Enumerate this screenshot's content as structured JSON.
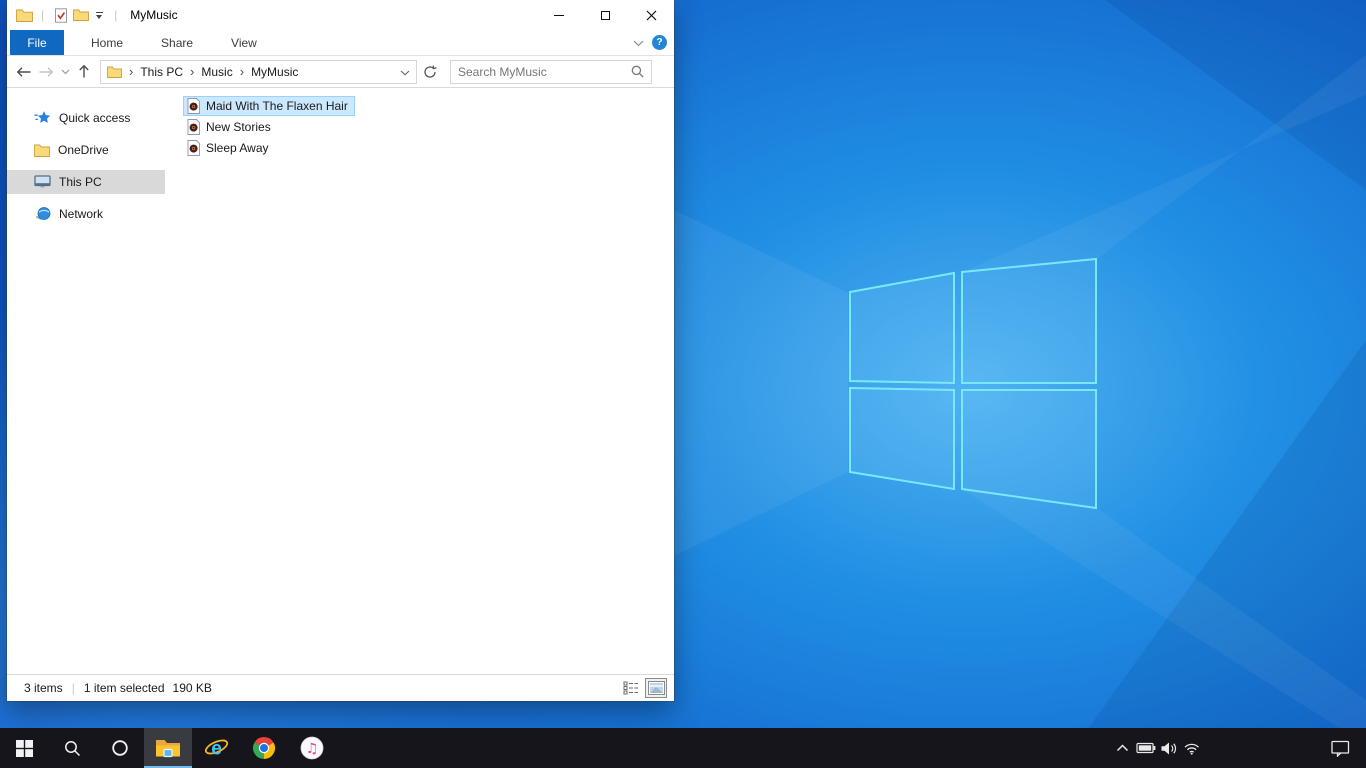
{
  "wallpaper": {
    "light_center": "#37a7ef",
    "dark_edge": "#0d51c0",
    "logo_stroke": "#79e9fa"
  },
  "explorer": {
    "title": "MyMusic",
    "titlebar_separator": "|",
    "tabs": {
      "file": "File",
      "home": "Home",
      "share": "Share",
      "view": "View"
    },
    "help_glyph": "?",
    "breadcrumb": {
      "crumbs": [
        "This PC",
        "Music",
        "MyMusic"
      ],
      "separator": "›"
    },
    "search": {
      "placeholder": "Search MyMusic"
    },
    "sidebar": {
      "items": [
        {
          "label": "Quick access",
          "icon": "quick-access-star"
        },
        {
          "label": "OneDrive",
          "icon": "folder"
        },
        {
          "label": "This PC",
          "icon": "monitor",
          "selected": true
        },
        {
          "label": "Network",
          "icon": "network-globe"
        }
      ]
    },
    "files": {
      "items": [
        {
          "name": "Maid With The Flaxen Hair",
          "icon": "music-file",
          "selected": true
        },
        {
          "name": "New Stories",
          "icon": "music-file"
        },
        {
          "name": "Sleep Away",
          "icon": "music-file"
        }
      ]
    },
    "status": {
      "count": "3 items",
      "separator": "|",
      "selection": "1 item selected",
      "size": "190 KB"
    }
  },
  "taskbar": {
    "icons": [
      "start",
      "search",
      "cortana",
      "file-explorer",
      "internet-explorer",
      "chrome",
      "itunes"
    ],
    "tray_icons": [
      "tray-expand-chevron",
      "battery",
      "volume",
      "wifi",
      "action-center"
    ],
    "active_app": "file-explorer"
  },
  "colors": {
    "tab_active_bg": "#1168c0",
    "selection_bg": "#cce8ff",
    "selection_border": "#99d1ff",
    "sidebar_selected_bg": "#d9d9d9",
    "taskbar_bg": "#15151b",
    "taskbar_active_underline": "#76b9ed",
    "help_button_bg": "#2385d6"
  }
}
